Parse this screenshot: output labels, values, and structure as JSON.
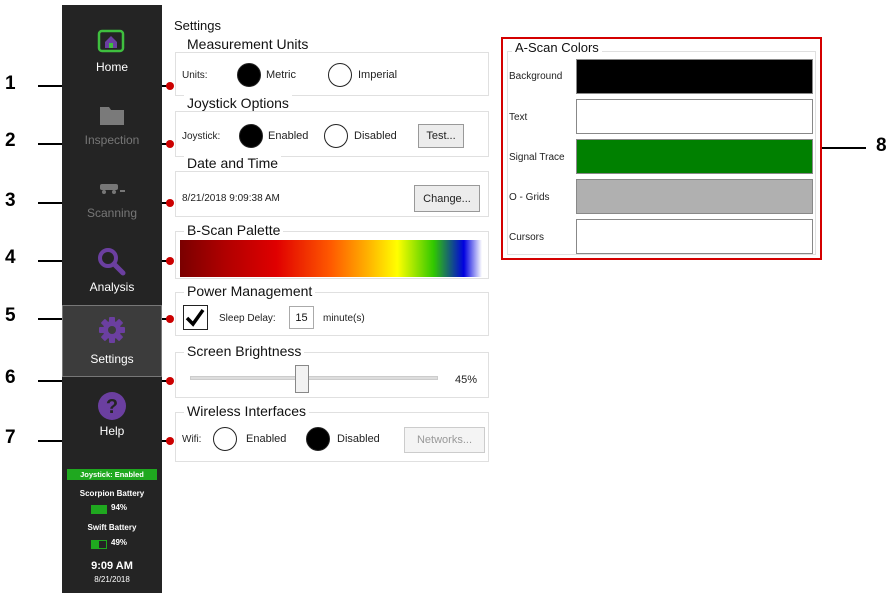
{
  "callouts": [
    "1",
    "2",
    "3",
    "4",
    "5",
    "6",
    "7",
    "8"
  ],
  "sidebar": {
    "items": [
      {
        "label": "Home",
        "icon": "home-icon"
      },
      {
        "label": "Inspection",
        "icon": "folder-icon"
      },
      {
        "label": "Scanning",
        "icon": "scanner-icon"
      },
      {
        "label": "Analysis",
        "icon": "search-icon"
      },
      {
        "label": "Settings",
        "icon": "gear-icon"
      },
      {
        "label": "Help",
        "icon": "help-icon"
      }
    ],
    "active": "Settings",
    "joystick_status": "Joystick: Enabled",
    "scorpion_label": "Scorpion Battery",
    "scorpion_value": "94%",
    "swift_label": "Swift Battery",
    "swift_value": "49%",
    "time": "9:09 AM",
    "date": "8/21/2018",
    "colors": {
      "background": "#242424",
      "accent": "#1fa81f",
      "icon_purple": "#6b3fa0"
    }
  },
  "settings": {
    "title": "Settings",
    "units": {
      "title": "Measurement Units",
      "label": "Units:",
      "options": [
        "Metric",
        "Imperial"
      ],
      "selected": "Metric"
    },
    "joystick": {
      "title": "Joystick Options",
      "label": "Joystick:",
      "options": [
        "Enabled",
        "Disabled"
      ],
      "selected": "Enabled",
      "test_button": "Test..."
    },
    "datetime": {
      "title": "Date and Time",
      "value": "8/21/2018 9:09:38 AM",
      "change_button": "Change..."
    },
    "bscan": {
      "title": "B-Scan Palette"
    },
    "power": {
      "title": "Power Management",
      "checked": true,
      "sleep_label": "Sleep Delay:",
      "sleep_value": "15",
      "unit": "minute(s)"
    },
    "brightness": {
      "title": "Screen Brightness",
      "value_text": "45%",
      "level": 0.45
    },
    "wireless": {
      "title": "Wireless Interfaces",
      "label": "Wifi:",
      "options": [
        "Enabled",
        "Disabled"
      ],
      "selected": "Disabled",
      "networks_button": "Networks..."
    }
  },
  "ascan": {
    "title": "A-Scan Colors",
    "rows": [
      {
        "label": "Background",
        "color": "#000000"
      },
      {
        "label": "Text",
        "color": "#ffffff"
      },
      {
        "label": "Signal Trace",
        "color": "#008000"
      },
      {
        "label": "O - Grids",
        "color": "#b0b0b0"
      },
      {
        "label": "Cursors",
        "color": "#ffffff"
      }
    ],
    "border_color": "#d40000"
  }
}
